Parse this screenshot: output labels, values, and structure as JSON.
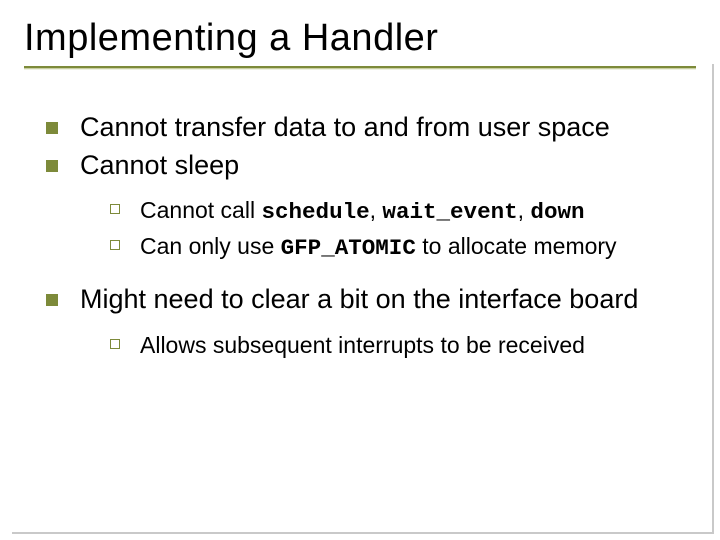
{
  "title": "Implementing a Handler",
  "items": [
    {
      "text": "Cannot transfer data to and from user space",
      "sub": []
    },
    {
      "text": "Cannot sleep",
      "sub": [
        {
          "prefix": "Cannot call ",
          "c1": "schedule",
          "mid1": ", ",
          "c2": "wait_event",
          "mid2": ", ",
          "c3": "down"
        },
        {
          "prefix": "Can only use ",
          "c1": "GFP_ATOMIC",
          "suffix": " to allocate memory"
        }
      ]
    },
    {
      "text": "Might need to clear a bit on the interface board",
      "sub": [
        {
          "plain": "Allows subsequent interrupts to be received"
        }
      ]
    }
  ]
}
